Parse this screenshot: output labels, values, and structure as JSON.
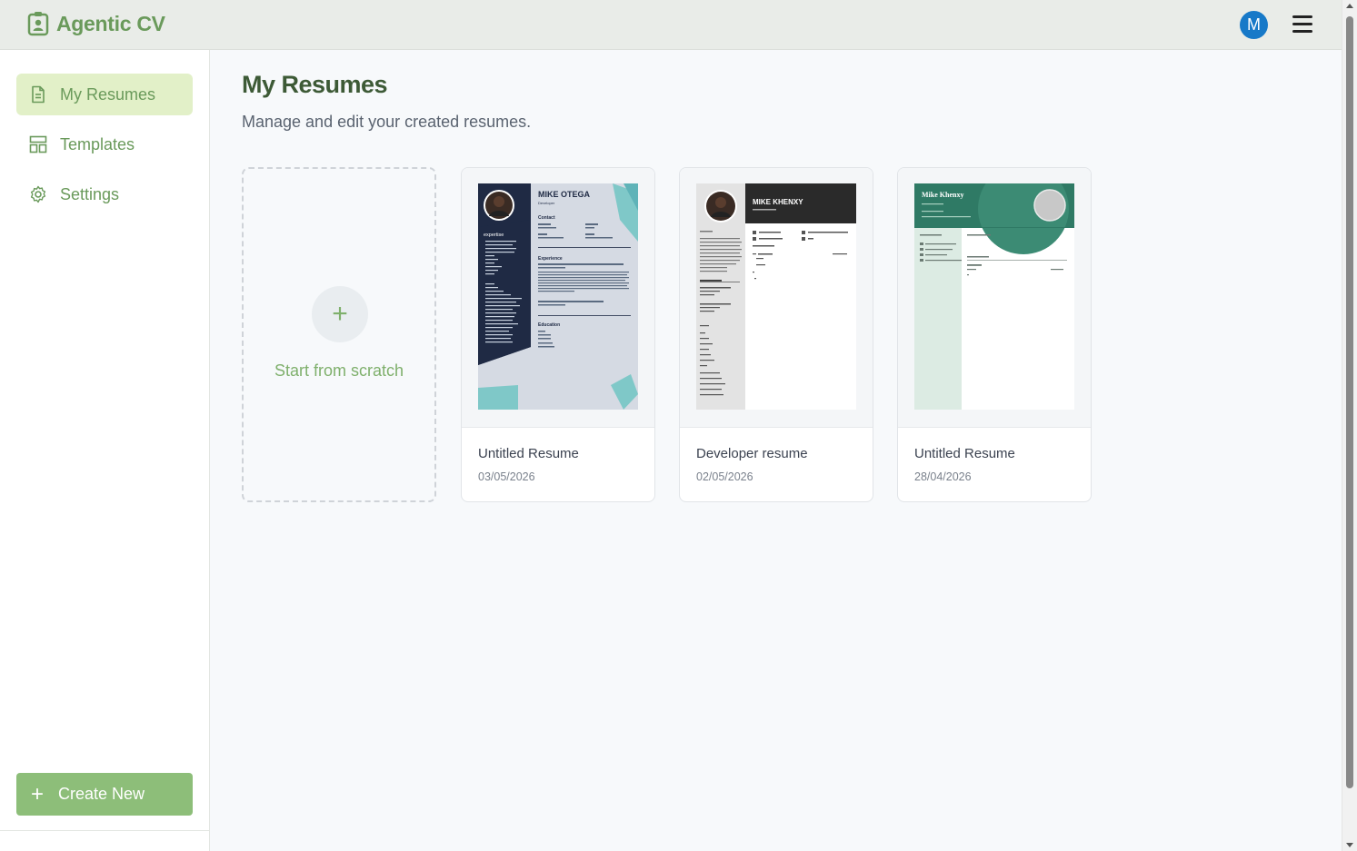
{
  "app": {
    "name": "Agentic CV"
  },
  "header": {
    "avatar_initial": "M"
  },
  "sidebar": {
    "items": [
      {
        "label": "My Resumes",
        "icon": "document-icon",
        "active": true
      },
      {
        "label": "Templates",
        "icon": "layout-icon",
        "active": false
      },
      {
        "label": "Settings",
        "icon": "gear-icon",
        "active": false
      }
    ],
    "create_label": "Create New"
  },
  "main": {
    "title": "My Resumes",
    "subtitle": "Manage and edit your created resumes.",
    "scratch_label": "Start from scratch",
    "resumes": [
      {
        "name": "Untitled Resume",
        "date": "03/05/2026",
        "preview": {
          "name": "MIKE OTEGA",
          "role": "Developer",
          "heading_contact": "Contact",
          "heading_expertise": "expertise",
          "heading_experience": "Experience",
          "heading_education": "Education"
        }
      },
      {
        "name": "Developer resume",
        "date": "02/05/2026",
        "preview": {
          "name": "MIKE KHENXY"
        }
      },
      {
        "name": "Untitled Resume",
        "date": "28/04/2026",
        "preview": {
          "name": "Mike Khenxy"
        }
      }
    ]
  },
  "colors": {
    "accent": "#6a9a5b",
    "active_bg": "#e2f0c8",
    "button": "#8dbe79",
    "avatar": "#1779c8"
  }
}
